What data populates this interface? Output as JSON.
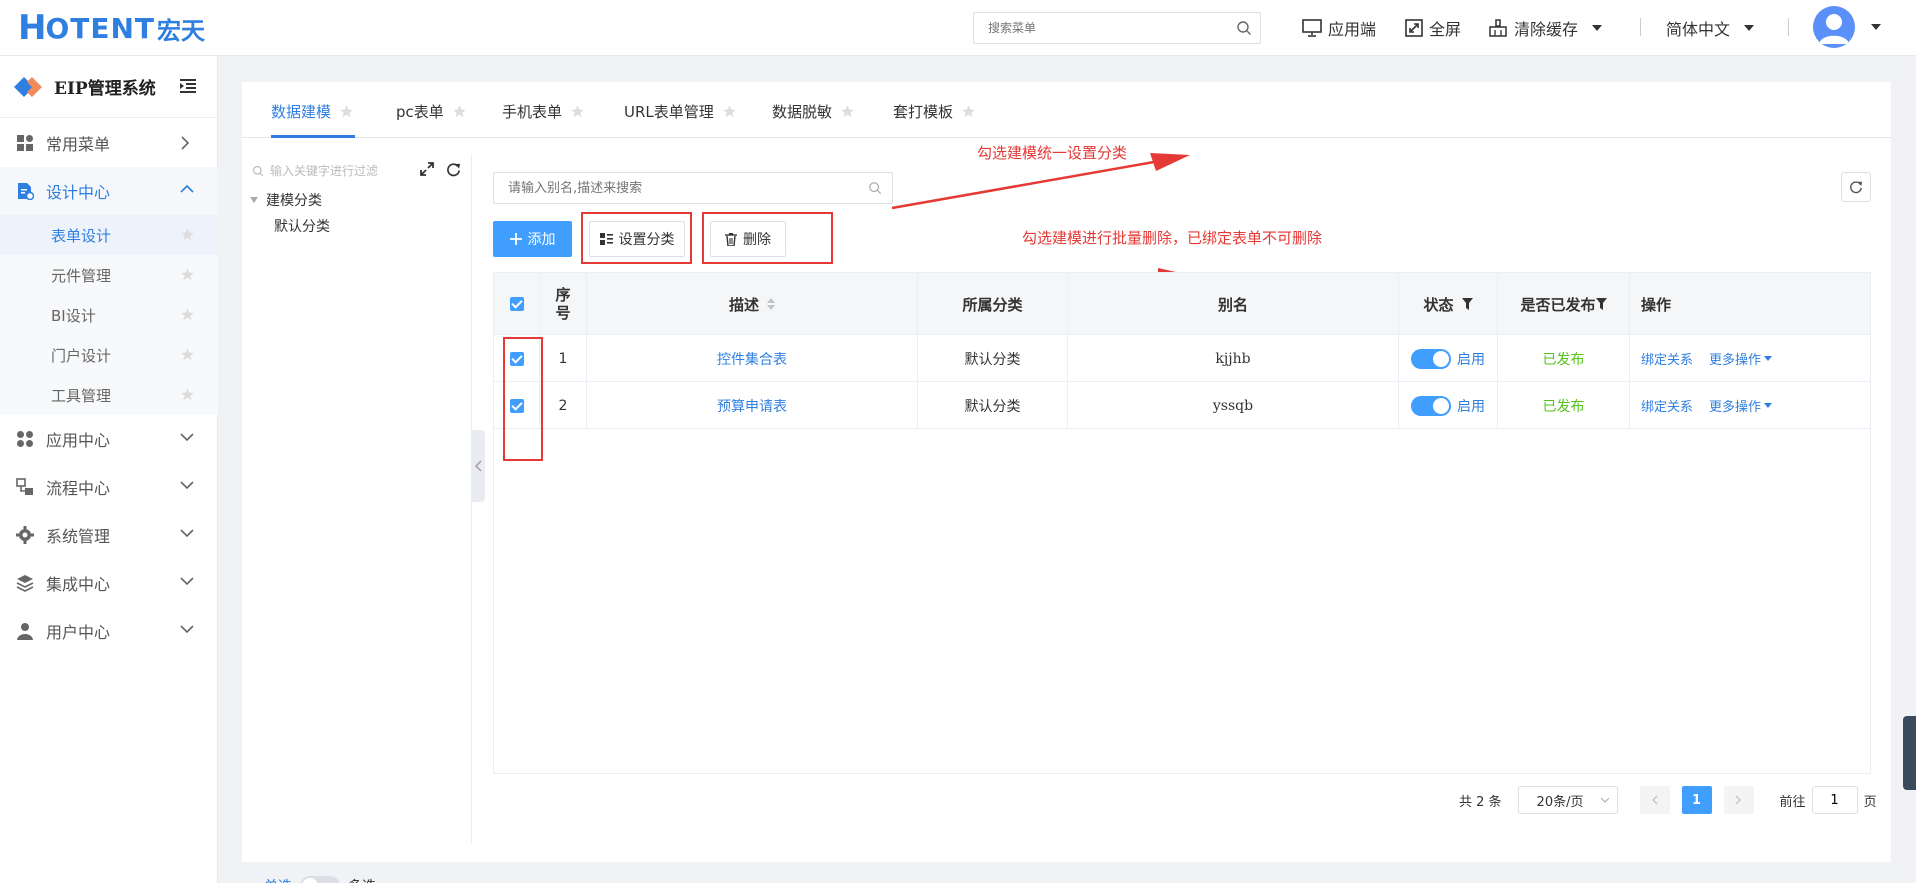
{
  "header": {
    "logo_h": "H",
    "logo_rest": "OTENT",
    "logo_cn": "宏天",
    "search_placeholder": "搜索菜单",
    "app_client": "应用端",
    "fullscreen": "全屏",
    "clear_cache": "清除缓存",
    "language": "简体中文"
  },
  "sidebar": {
    "system_title": "EIP管理系统",
    "items": [
      {
        "label": "常用菜单",
        "icon": "grid-icon"
      },
      {
        "label": "设计中心",
        "icon": "design-doc-icon"
      },
      {
        "label": "应用中心",
        "icon": "apps-icon"
      },
      {
        "label": "流程中心",
        "icon": "flow-icon"
      },
      {
        "label": "系统管理",
        "icon": "gear-icon"
      },
      {
        "label": "集成中心",
        "icon": "layers-icon"
      },
      {
        "label": "用户中心",
        "icon": "user-icon"
      }
    ],
    "design_sub": [
      "表单设计",
      "元件管理",
      "BI设计",
      "门户设计",
      "工具管理"
    ]
  },
  "tabs": [
    "数据建模",
    "pc表单",
    "手机表单",
    "URL表单管理",
    "数据脱敏",
    "套打模板"
  ],
  "tree": {
    "filter_placeholder": "输入关键字进行过滤",
    "root": "建模分类",
    "child": "默认分类",
    "single": "单选",
    "multi": "多选"
  },
  "toolbar": {
    "search_placeholder": "请输入别名,描述来搜索",
    "add": "添加",
    "set_category": "设置分类",
    "delete": "删除"
  },
  "annotations": {
    "set_category_note": "勾选建模统一设置分类",
    "delete_note": "勾选建模进行批量删除，已绑定表单不可删除"
  },
  "table": {
    "columns": {
      "index_1": "序",
      "index_2": "号",
      "desc": "描述",
      "category": "所属分类",
      "alias": "别名",
      "status": "状态",
      "published": "是否已发布",
      "actions": "操作"
    },
    "rows": [
      {
        "index": "1",
        "desc": "控件集合表",
        "category": "默认分类",
        "alias": "kjjhb",
        "status": "启用",
        "published": "已发布",
        "bind": "绑定关系",
        "more": "更多操作"
      },
      {
        "index": "2",
        "desc": "预算申请表",
        "category": "默认分类",
        "alias": "yssqb",
        "status": "启用",
        "published": "已发布",
        "bind": "绑定关系",
        "more": "更多操作"
      }
    ]
  },
  "pagination": {
    "total": "共 2 条",
    "page_size": "20条/页",
    "current_page": "1",
    "goto_label": "前往",
    "goto_value": "1",
    "page_unit": "页"
  }
}
